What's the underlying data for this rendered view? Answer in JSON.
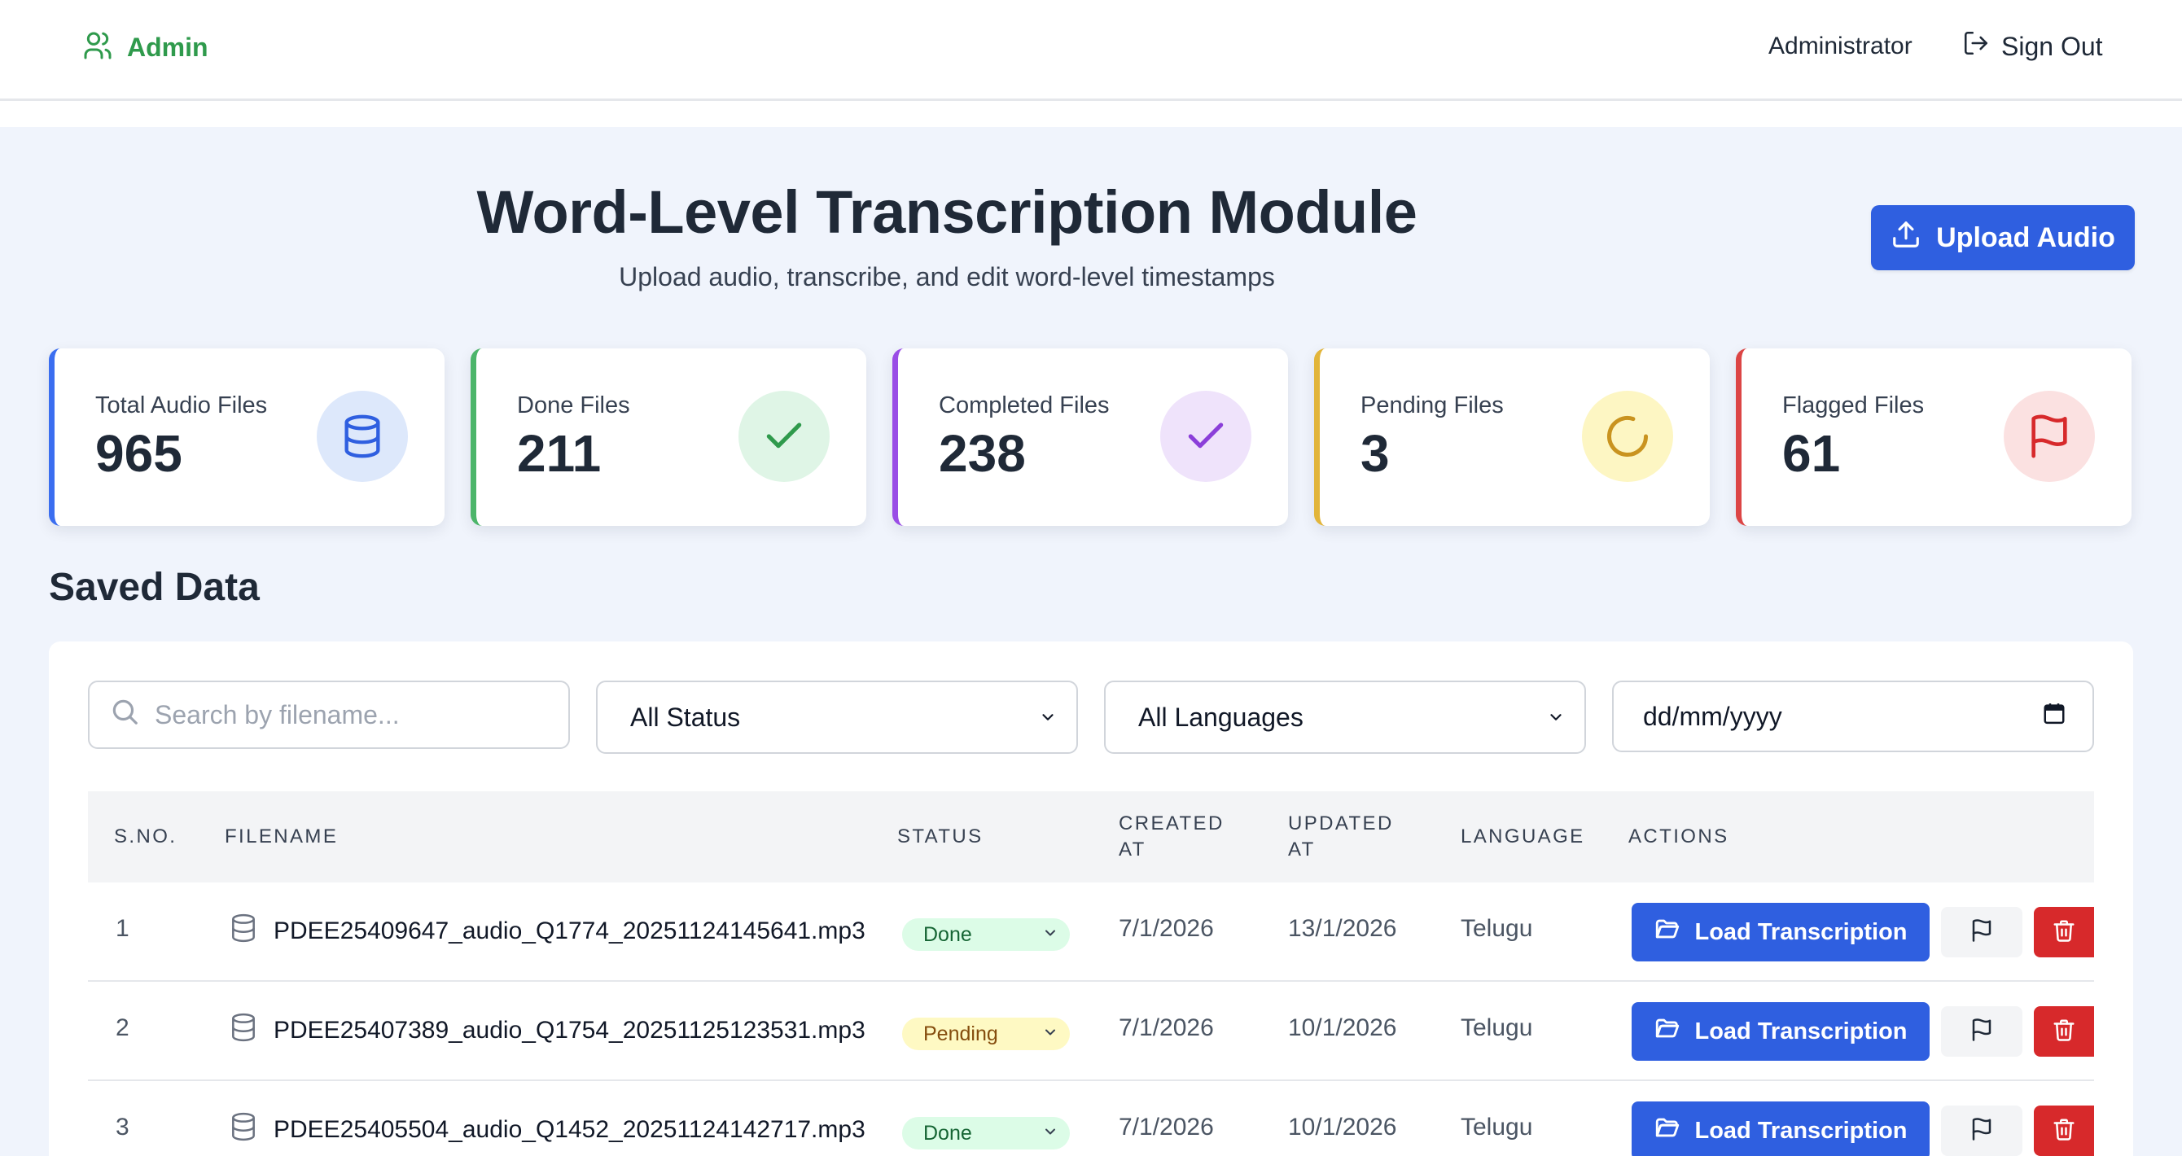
{
  "header": {
    "brand_label": "Admin",
    "user_name": "Administrator",
    "signout_label": "Sign Out"
  },
  "page": {
    "title": "Word-Level Transcription Module",
    "subtitle": "Upload audio, transcribe, and edit word-level timestamps",
    "upload_label": "Upload Audio"
  },
  "stats": [
    {
      "label": "Total Audio Files",
      "value": "965",
      "icon": "database-icon",
      "accent": "#3b6ef0",
      "icon_bg": "#dde8fb",
      "icon_color": "#2f5fe0"
    },
    {
      "label": "Done Files",
      "value": "211",
      "icon": "check-icon",
      "accent": "#4cb56a",
      "icon_bg": "#dff5e6",
      "icon_color": "#2f9a4c"
    },
    {
      "label": "Completed Files",
      "value": "238",
      "icon": "check-icon",
      "accent": "#9a4de6",
      "icon_bg": "#efe3fb",
      "icon_color": "#8b3fd9"
    },
    {
      "label": "Pending Files",
      "value": "3",
      "icon": "spinner-icon",
      "accent": "#e2b53a",
      "icon_bg": "#fdf6c3",
      "icon_color": "#c9931f"
    },
    {
      "label": "Flagged Files",
      "value": "61",
      "icon": "flag-icon",
      "accent": "#dc4545",
      "icon_bg": "#fbe1e1",
      "icon_color": "#d7292b"
    }
  ],
  "saved": {
    "title": "Saved Data",
    "search_placeholder": "Search by filename...",
    "status_filter": "All Status",
    "language_filter": "All Languages",
    "date_placeholder": "dd/mm/yyyy"
  },
  "table": {
    "columns": {
      "sno": "S.NO.",
      "filename": "FILENAME",
      "status": "STATUS",
      "created_1": "CREATED",
      "created_2": "AT",
      "updated_1": "UPDATED",
      "updated_2": "AT",
      "language": "LANGUAGE",
      "actions": "ACTIONS"
    },
    "load_label": "Load Transcription",
    "rows": [
      {
        "sno": "1",
        "filename": "PDEE25409647_audio_Q1774_20251124145641.mp3",
        "status": "Done",
        "status_kind": "done",
        "created": "7/1/2026",
        "updated": "13/1/2026",
        "language": "Telugu"
      },
      {
        "sno": "2",
        "filename": "PDEE25407389_audio_Q1754_20251125123531.mp3",
        "status": "Pending",
        "status_kind": "pending",
        "created": "7/1/2026",
        "updated": "10/1/2026",
        "language": "Telugu"
      },
      {
        "sno": "3",
        "filename": "PDEE25405504_audio_Q1452_20251124142717.mp3",
        "status": "Done",
        "status_kind": "done",
        "created": "7/1/2026",
        "updated": "10/1/2026",
        "language": "Telugu"
      }
    ]
  }
}
